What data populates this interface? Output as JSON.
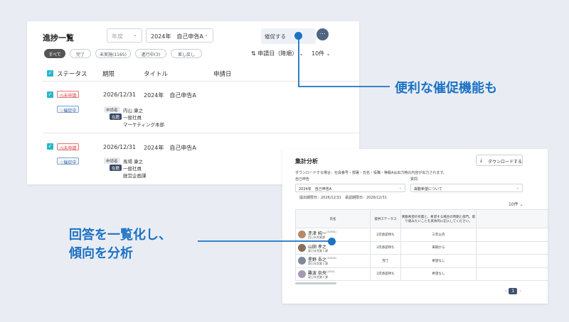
{
  "colors": {
    "accent": "#1c72c4",
    "teal": "#2bb7c9",
    "danger": "#d94d4d"
  },
  "progress": {
    "title": "進捗一覧",
    "filter_year_placeholder": "年度",
    "filter_form_value": "2024年　自己申告A",
    "chips": [
      "すべて",
      "完了",
      "未実施(1165)",
      "進行中(3)",
      "差し戻し"
    ],
    "sort_label": "申請日（降順）",
    "per_page": "10件",
    "remind_label": "催促する",
    "more_label": "⋯",
    "columns": [
      "ステータス",
      "期限",
      "タイトル",
      "申請日"
    ],
    "rows": [
      {
        "status": "未申請",
        "reminding": "催促中",
        "deadline": "2026/12/31",
        "title": "2024年　自己申告A",
        "applicant_label": "申請者",
        "name": "内山 康之",
        "status_label": "在籍",
        "position": "一般社員",
        "department": "マーケティング本部"
      },
      {
        "status": "未申請",
        "reminding": "催促中",
        "deadline": "2026/12/31",
        "title": "2024年　自己申告A",
        "applicant_label": "申請者",
        "name": "馬場 康之",
        "status_label": "在籍",
        "position": "一般社員",
        "department": "経営企画課"
      }
    ]
  },
  "summary": {
    "title": "集計分析",
    "download_label": "ダウンロードする",
    "download_note": "ダウンロードする場合：社員番号・部署・氏名・役職・等級Aは出力時の内容が出力されます。",
    "form_label": "自己申告",
    "form_value": "2024年　自己申告A",
    "question_label": "質問",
    "question_value": "異動希望について",
    "submit_deadline": "提出期限日：2026/12/31",
    "approve_deadline": "承認期限日：2026/12/31",
    "per_page": "10件",
    "columns": [
      "氏名",
      "提供ステータス",
      "異動希望の有無と、希望する場合の時期と部門。取り組みたいことを具体的に記入してください。",
      ""
    ],
    "rows": [
      {
        "name": "赤津 純一",
        "id": "(10004)",
        "dept": "西日本営業課",
        "status": "2次承認待ち",
        "answer": "三年以内"
      },
      {
        "name": "山田 孝之",
        "id": "",
        "dept": "東日本営業１課",
        "status": "2次承認待ち",
        "answer": "来期から"
      },
      {
        "name": "星野 吾之",
        "id": "(10019)",
        "dept": "東日本営業１課",
        "status": "完了",
        "answer": "希望なし"
      },
      {
        "name": "難波 奈央",
        "id": "(1024)",
        "dept": "東日本営業１課",
        "status": "2次承認待ち",
        "answer": "希望なし"
      }
    ],
    "page": "1"
  },
  "callouts": {
    "remind": "便利な催促機能も",
    "analyze_line1": "回答を一覧化し、",
    "analyze_line2": "傾向を分析"
  }
}
